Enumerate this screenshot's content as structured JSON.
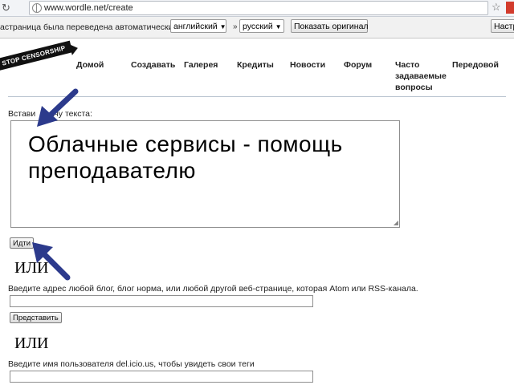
{
  "browser": {
    "url": "www.wordle.net/create",
    "reload_icon": "reload-icon",
    "star_icon": "star-icon"
  },
  "translate_bar": {
    "message": "астраница была переведена автоматически",
    "from_language": "английский",
    "to_language": "русский",
    "show_original_label": "Показать оригинал",
    "settings_label": "Настр"
  },
  "ribbon": {
    "text": "STOP CENSORSHIP"
  },
  "nav": {
    "items": [
      "Домой",
      "Создавать",
      "Галерея",
      "Кредиты",
      "Новости",
      "Форум",
      "Часто задаваемые вопросы",
      "Передовой"
    ]
  },
  "content": {
    "paste_label": "Встави      ачу текста:",
    "textarea_value": "Облачные сервисы - помощь преподавателю",
    "go_button": "Идти",
    "or_label": "ИЛИ",
    "blog_label": "Введите адрес любой блог, блог норма, или любой другой веб-странице, которая Atom или RSS-канала.",
    "submit_button": "Представить",
    "delicious_label": "Введите имя пользователя del.icio.us, чтобы увидеть свои теги"
  },
  "colors": {
    "arrow": "#2c3a8c",
    "ribbon": "#111111"
  }
}
